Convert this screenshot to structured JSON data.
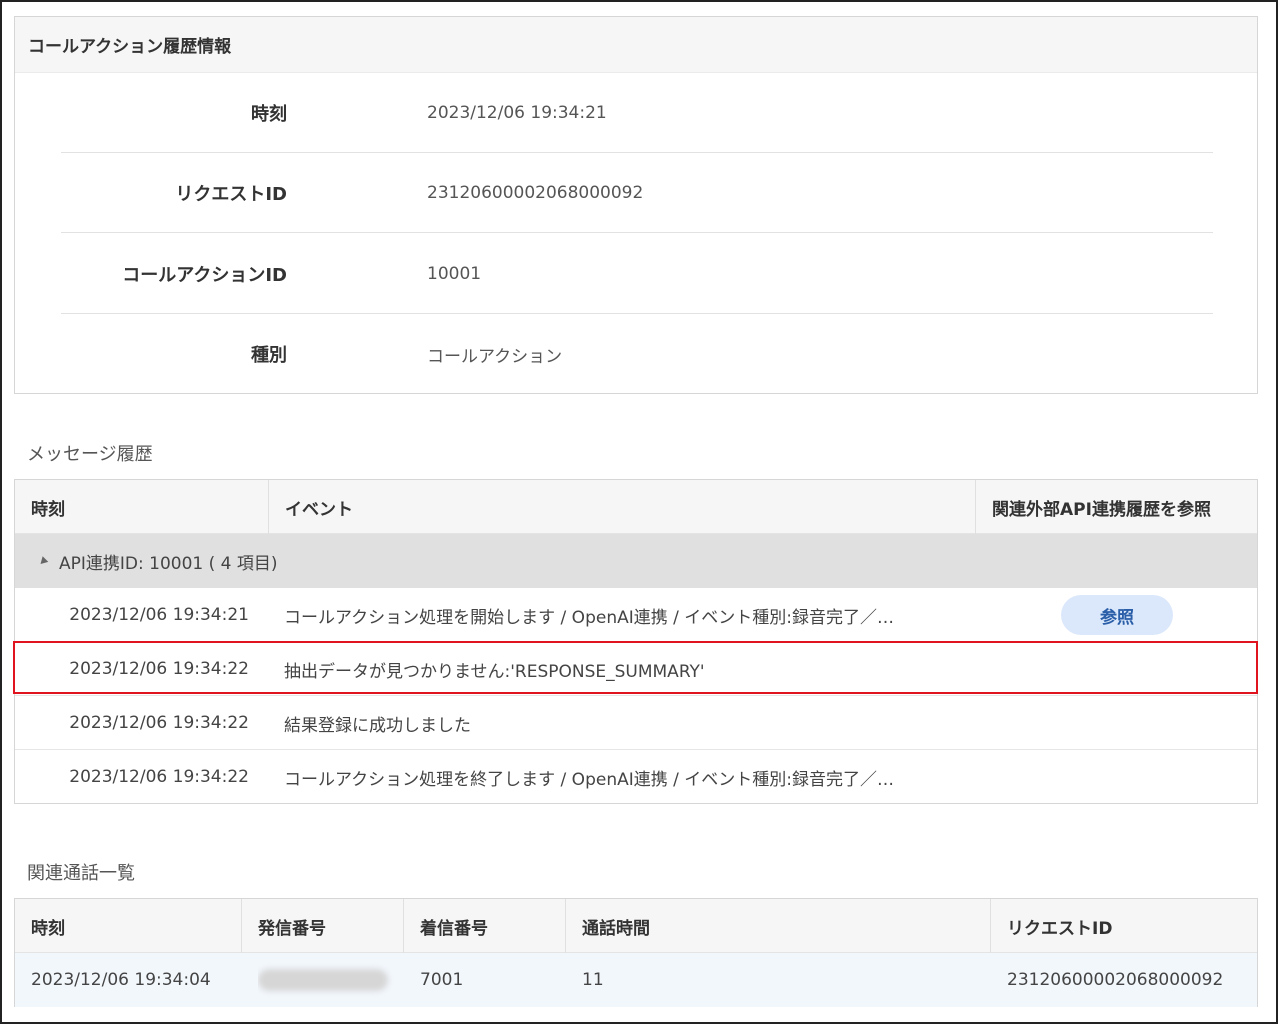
{
  "info_panel": {
    "title": "コールアクション履歴情報",
    "rows": [
      {
        "label": "時刻",
        "value": "2023/12/06 19:34:21"
      },
      {
        "label": "リクエストID",
        "value": "23120600002068000092"
      },
      {
        "label": "コールアクションID",
        "value": "10001"
      },
      {
        "label": "種別",
        "value": "コールアクション"
      }
    ]
  },
  "message_history": {
    "title": "メッセージ履歴",
    "columns": [
      "時刻",
      "イベント",
      "関連外部API連携履歴を参照"
    ],
    "group_label": "API連携ID: 10001 ( 4 項目)",
    "rows": [
      {
        "time": "2023/12/06 19:34:21",
        "event": "コールアクション処理を開始します / OpenAI連携 / イベント種別:録音完了／…",
        "ref_label": "参照"
      },
      {
        "time": "2023/12/06 19:34:22",
        "event": "抽出データが見つかりません:'RESPONSE_SUMMARY'",
        "highlighted": true
      },
      {
        "time": "2023/12/06 19:34:22",
        "event": "結果登録に成功しました"
      },
      {
        "time": "2023/12/06 19:34:22",
        "event": "コールアクション処理を終了します / OpenAI連携 / イベント種別:録音完了／…"
      }
    ]
  },
  "related_calls": {
    "title": "関連通話一覧",
    "columns": [
      "時刻",
      "発信番号",
      "着信番号",
      "通話時間",
      "リクエストID"
    ],
    "rows": [
      {
        "time": "2023/12/06 19:34:04",
        "caller": "",
        "callee": "7001",
        "duration": "11",
        "request_id": "23120600002068000092"
      }
    ]
  },
  "colors": {
    "highlight": "#e0141e",
    "ref_button_bg": "#dbe8fb",
    "ref_button_text": "#2a5ea8"
  }
}
